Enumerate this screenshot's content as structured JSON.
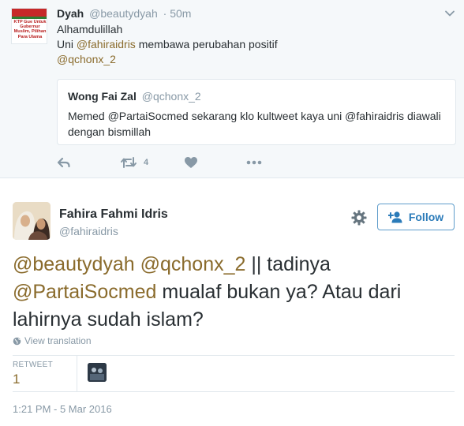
{
  "context_tweet": {
    "avatar_text": "KTP Gue Untuk Gubernur Muslim, Pilihan Para Ulama",
    "name": "Dyah",
    "handle": "@beautydyah",
    "time": "50m",
    "line1": "Alhamdulillah",
    "line2_prefix": "Uni ",
    "line2_mention": "@fahiraidris",
    "line2_suffix": " membawa perubahan positif",
    "line3_mention": "@qchonx_2",
    "quote": {
      "name": "Wong Fai Zal",
      "handle": "@qchonx_2",
      "text": "Memed @PartaiSocmed sekarang klo kultweet kaya uni @fahiraidris diawali dengan bismillah"
    },
    "actions": {
      "reply_icon": "reply-icon",
      "retweet_icon": "retweet-icon",
      "retweet_count": "4",
      "like_icon": "heart-icon",
      "more_icon": "more-icon"
    }
  },
  "main_tweet": {
    "name": "Fahira Fahmi Idris",
    "handle": "@fahiraidris",
    "follow_label": "Follow",
    "text": {
      "mention1": "@beautydyah",
      "mention2": "@qchonx_2",
      "part1": " || tadinya ",
      "mention3": "@PartaiSocmed",
      "part2": " mualaf bukan ya? Atau dari lahirnya sudah islam?"
    },
    "view_translation": "View translation",
    "retweet_label": "RETWEET",
    "retweet_count": "1",
    "timestamp": "1:21 PM - 5 Mar 2016"
  },
  "colors": {
    "link": "#8a6b2c",
    "muted": "#8899a6",
    "follow_blue": "#2b7bb9",
    "context_bg": "#f5f8fa"
  }
}
